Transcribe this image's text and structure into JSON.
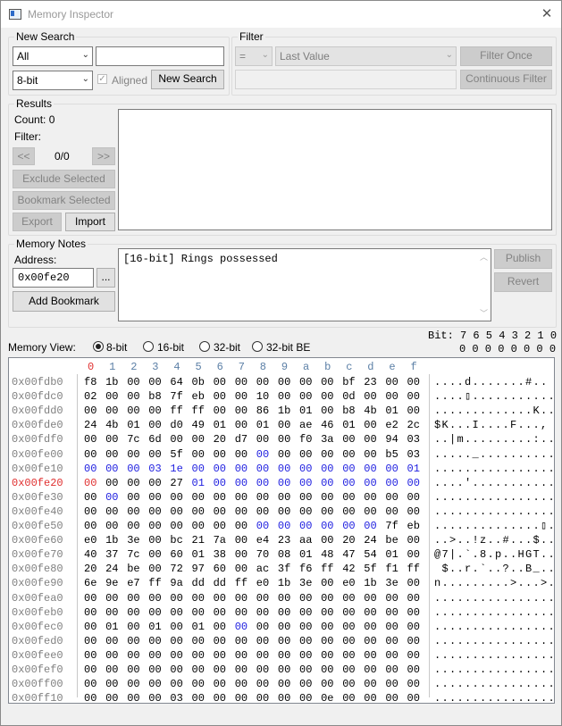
{
  "window": {
    "title": "Memory Inspector"
  },
  "new_search": {
    "legend": "New Search",
    "search_type": "All",
    "data_size": "8-bit",
    "value": "",
    "aligned_label": "Aligned",
    "new_search_button": "New Search"
  },
  "filter": {
    "legend": "Filter",
    "operator": "=",
    "compare_to": "Last Value",
    "value": "",
    "filter_once_button": "Filter Once",
    "continuous_filter_button": "Continuous Filter"
  },
  "results": {
    "legend": "Results",
    "count_label": "Count: 0",
    "filter_label": "Filter:",
    "prev_button": "<<",
    "page_label": "0/0",
    "next_button": ">>",
    "exclude_button": "Exclude Selected",
    "bookmark_button": "Bookmark Selected",
    "export_button": "Export",
    "import_button": "Import"
  },
  "memory_notes": {
    "legend": "Memory Notes",
    "address_label": "Address:",
    "address_value": "0x00fe20",
    "browse_button": "...",
    "add_bookmark_button": "Add Bookmark",
    "note_text": "[16-bit] Rings possessed",
    "publish_button": "Publish",
    "revert_button": "Revert"
  },
  "memory_view": {
    "label": "Memory View:",
    "options": [
      "8-bit",
      "16-bit",
      "32-bit",
      "32-bit BE"
    ],
    "selected": "8-bit",
    "bit_header": "Bit: 7 6 5 4 3 2 1 0",
    "bit_values": "0 0 0 0 0 0 0 0",
    "highlight_row": "0x00fe20",
    "columns": [
      "0",
      "1",
      "2",
      "3",
      "4",
      "5",
      "6",
      "7",
      "8",
      "9",
      "a",
      "b",
      "c",
      "d",
      "e",
      "f"
    ],
    "rows": [
      {
        "addr": "0x00fdb0",
        "bytes": [
          "f8",
          "1b",
          "00",
          "00",
          "64",
          "0b",
          "00",
          "00",
          "00",
          "00",
          "00",
          "00",
          "bf",
          "23",
          "00",
          "00"
        ],
        "ascii": "....d.......#.."
      },
      {
        "addr": "0x00fdc0",
        "bytes": [
          "02",
          "00",
          "00",
          "b8",
          "7f",
          "eb",
          "00",
          "00",
          "10",
          "00",
          "00",
          "00",
          "0d",
          "00",
          "00",
          "00"
        ],
        "ascii": "....▯..........."
      },
      {
        "addr": "0x00fdd0",
        "bytes": [
          "00",
          "00",
          "00",
          "00",
          "ff",
          "ff",
          "00",
          "00",
          "86",
          "1b",
          "01",
          "00",
          "b8",
          "4b",
          "01",
          "00"
        ],
        "ascii": ".............K.."
      },
      {
        "addr": "0x00fde0",
        "bytes": [
          "24",
          "4b",
          "01",
          "00",
          "d0",
          "49",
          "01",
          "00",
          "01",
          "00",
          "ae",
          "46",
          "01",
          "00",
          "e2",
          "2c"
        ],
        "ascii": "$K...I....F...,"
      },
      {
        "addr": "0x00fdf0",
        "bytes": [
          "00",
          "00",
          "7c",
          "6d",
          "00",
          "00",
          "20",
          "d7",
          "00",
          "00",
          "f0",
          "3a",
          "00",
          "00",
          "94",
          "03"
        ],
        "ascii": "..|m.........:.."
      },
      {
        "addr": "0x00fe00",
        "bytes": [
          "00",
          "00",
          "00",
          "00",
          "5f",
          "00",
          "00",
          "00",
          "00",
          "00",
          "00",
          "00",
          "00",
          "00",
          "b5",
          "03"
        ],
        "ascii": "....._.........."
      },
      {
        "addr": "0x00fe10",
        "bytes": [
          "00",
          "00",
          "00",
          "03",
          "1e",
          "00",
          "00",
          "00",
          "00",
          "00",
          "00",
          "00",
          "00",
          "00",
          "00",
          "01"
        ],
        "ascii": "................"
      },
      {
        "addr": "0x00fe20",
        "bytes": [
          "00",
          "00",
          "00",
          "00",
          "27",
          "01",
          "00",
          "00",
          "00",
          "00",
          "00",
          "00",
          "00",
          "00",
          "00",
          "00"
        ],
        "ascii": "....'..........."
      },
      {
        "addr": "0x00fe30",
        "bytes": [
          "00",
          "00",
          "00",
          "00",
          "00",
          "00",
          "00",
          "00",
          "00",
          "00",
          "00",
          "00",
          "00",
          "00",
          "00",
          "00"
        ],
        "ascii": "................"
      },
      {
        "addr": "0x00fe40",
        "bytes": [
          "00",
          "00",
          "00",
          "00",
          "00",
          "00",
          "00",
          "00",
          "00",
          "00",
          "00",
          "00",
          "00",
          "00",
          "00",
          "00"
        ],
        "ascii": "................"
      },
      {
        "addr": "0x00fe50",
        "bytes": [
          "00",
          "00",
          "00",
          "00",
          "00",
          "00",
          "00",
          "00",
          "00",
          "00",
          "00",
          "00",
          "00",
          "00",
          "7f",
          "eb"
        ],
        "ascii": "..............▯."
      },
      {
        "addr": "0x00fe60",
        "bytes": [
          "e0",
          "1b",
          "3e",
          "00",
          "bc",
          "21",
          "7a",
          "00",
          "e4",
          "23",
          "aa",
          "00",
          "20",
          "24",
          "be",
          "00"
        ],
        "ascii": "..>..!z..#...$.."
      },
      {
        "addr": "0x00fe70",
        "bytes": [
          "40",
          "37",
          "7c",
          "00",
          "60",
          "01",
          "38",
          "00",
          "70",
          "08",
          "01",
          "48",
          "47",
          "54",
          "01",
          "00"
        ],
        "ascii": "@7|.`.8.p..HGT.."
      },
      {
        "addr": "0x00fe80",
        "bytes": [
          "20",
          "24",
          "be",
          "00",
          "72",
          "97",
          "60",
          "00",
          "ac",
          "3f",
          "f6",
          "ff",
          "42",
          "5f",
          "f1",
          "ff"
        ],
        "ascii": " $..r.`..?..B_.."
      },
      {
        "addr": "0x00fe90",
        "bytes": [
          "6e",
          "9e",
          "e7",
          "ff",
          "9a",
          "dd",
          "dd",
          "ff",
          "e0",
          "1b",
          "3e",
          "00",
          "e0",
          "1b",
          "3e",
          "00"
        ],
        "ascii": "n.........>...>."
      },
      {
        "addr": "0x00fea0",
        "bytes": [
          "00",
          "00",
          "00",
          "00",
          "00",
          "00",
          "00",
          "00",
          "00",
          "00",
          "00",
          "00",
          "00",
          "00",
          "00",
          "00"
        ],
        "ascii": "................"
      },
      {
        "addr": "0x00feb0",
        "bytes": [
          "00",
          "00",
          "00",
          "00",
          "00",
          "00",
          "00",
          "00",
          "00",
          "00",
          "00",
          "00",
          "00",
          "00",
          "00",
          "00"
        ],
        "ascii": "................"
      },
      {
        "addr": "0x00fec0",
        "bytes": [
          "00",
          "01",
          "00",
          "01",
          "00",
          "01",
          "00",
          "00",
          "00",
          "00",
          "00",
          "00",
          "00",
          "00",
          "00",
          "00"
        ],
        "ascii": "................"
      },
      {
        "addr": "0x00fed0",
        "bytes": [
          "00",
          "00",
          "00",
          "00",
          "00",
          "00",
          "00",
          "00",
          "00",
          "00",
          "00",
          "00",
          "00",
          "00",
          "00",
          "00"
        ],
        "ascii": "................"
      },
      {
        "addr": "0x00fee0",
        "bytes": [
          "00",
          "00",
          "00",
          "00",
          "00",
          "00",
          "00",
          "00",
          "00",
          "00",
          "00",
          "00",
          "00",
          "00",
          "00",
          "00"
        ],
        "ascii": "................"
      },
      {
        "addr": "0x00fef0",
        "bytes": [
          "00",
          "00",
          "00",
          "00",
          "00",
          "00",
          "00",
          "00",
          "00",
          "00",
          "00",
          "00",
          "00",
          "00",
          "00",
          "00"
        ],
        "ascii": "................"
      },
      {
        "addr": "0x00ff00",
        "bytes": [
          "00",
          "00",
          "00",
          "00",
          "00",
          "00",
          "00",
          "00",
          "00",
          "00",
          "00",
          "00",
          "00",
          "00",
          "00",
          "00"
        ],
        "ascii": "................"
      },
      {
        "addr": "0x00ff10",
        "bytes": [
          "00",
          "00",
          "00",
          "00",
          "03",
          "00",
          "00",
          "00",
          "00",
          "00",
          "00",
          "0e",
          "00",
          "00",
          "00",
          "00"
        ],
        "ascii": "................"
      }
    ],
    "blue_cells": [
      [
        6,
        0
      ],
      [
        6,
        1
      ],
      [
        6,
        2
      ],
      [
        6,
        3
      ],
      [
        6,
        4
      ],
      [
        6,
        5
      ],
      [
        6,
        6
      ],
      [
        6,
        7
      ],
      [
        6,
        8
      ],
      [
        6,
        9
      ],
      [
        6,
        10
      ],
      [
        6,
        11
      ],
      [
        6,
        12
      ],
      [
        6,
        13
      ],
      [
        6,
        14
      ],
      [
        6,
        15
      ],
      [
        7,
        5
      ],
      [
        7,
        6
      ],
      [
        7,
        7
      ],
      [
        7,
        8
      ],
      [
        7,
        9
      ],
      [
        7,
        10
      ],
      [
        7,
        11
      ],
      [
        7,
        12
      ],
      [
        7,
        13
      ],
      [
        7,
        14
      ],
      [
        7,
        15
      ],
      [
        5,
        8
      ],
      [
        8,
        1
      ],
      [
        10,
        8
      ],
      [
        10,
        9
      ],
      [
        10,
        10
      ],
      [
        10,
        11
      ],
      [
        10,
        12
      ],
      [
        10,
        13
      ],
      [
        17,
        7
      ]
    ],
    "red_cells": [
      [
        7,
        0
      ]
    ]
  }
}
